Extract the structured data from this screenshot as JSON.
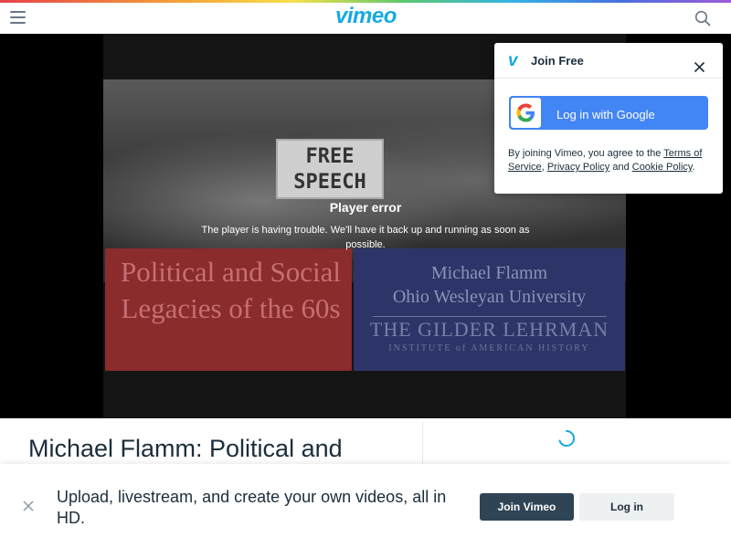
{
  "header": {
    "logo": "vimeo",
    "menu_icon": "hamburger-menu-icon",
    "search_icon": "search-icon"
  },
  "player": {
    "error_title": "Player error",
    "error_message": "The player is having trouble. We'll have it back up and running as soon as possible.",
    "thumbnail": {
      "sign_line1": "FREE",
      "sign_line2": "SPEECH",
      "left_text": "Political and Social Legacies of the 60s",
      "right_line1": "Michael Flamm",
      "right_line2": "Ohio Wesleyan University",
      "right_line3": "THE GILDER LEHRMAN",
      "right_line4": "INSTITUTE of AMERICAN HISTORY"
    }
  },
  "video": {
    "title": "Michael Flamm: Political and"
  },
  "signup_popup": {
    "logo": "v",
    "title": "Join Free",
    "google_button": "Log in with Google",
    "terms_prefix": "By joining Vimeo, you agree to the ",
    "terms_link": "Terms of Service",
    "terms_sep": ", ",
    "privacy_link": "Privacy Policy",
    "terms_and": " and ",
    "cookie_link": "Cookie Policy",
    "terms_end": "."
  },
  "bottom_bar": {
    "promo": "Upload, livestream, and create your own videos, all in HD.",
    "join_button": "Join Vimeo",
    "login_button": "Log in"
  },
  "colors": {
    "brand": "#17a9e1",
    "dark": "#1a2e3b",
    "join_button_bg": "#2f4455",
    "google_blue": "#4285f4"
  }
}
